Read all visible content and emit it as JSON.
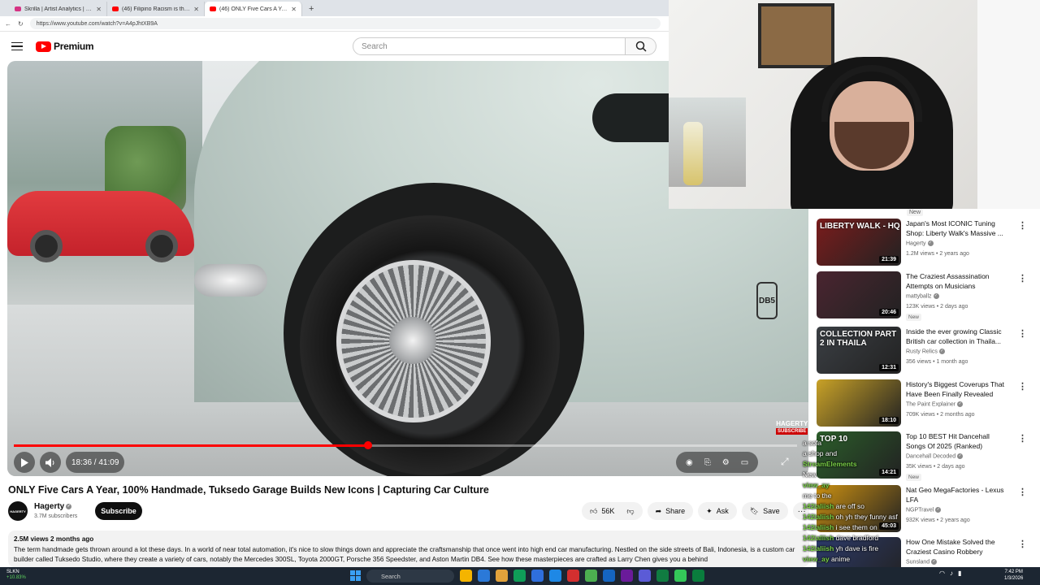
{
  "browser": {
    "tabs": [
      {
        "title": "Skrilla | Artist Analytics | Songstats",
        "fav_color": "#d63384"
      },
      {
        "title": "(46) Filipino Racism is the Most Cr",
        "fav_color": "#ff0000"
      },
      {
        "title": "(46) ONLY Five Cars A Year, 100% ..",
        "fav_color": "#ff0000"
      }
    ],
    "new_tab": "+",
    "url": "https://www.youtube.com/watch?v=A4pJhtXB9A"
  },
  "header": {
    "logo_text": "Premium",
    "search_placeholder": "Search"
  },
  "video": {
    "time_display": "18:36 / 41:09",
    "progress": 0.452,
    "db5_badge": "DB5",
    "watermark": "HAGERTY",
    "watermark_sub": "SUBSCRIBE"
  },
  "main": {
    "title": "ONLY Five Cars A Year, 100% Handmade, Tuksedo Garage Builds New Icons | Capturing Car Culture",
    "channel_name": "Hagerty",
    "avatar_text": "HAGERTY",
    "subscribers": "3.7M subscribers",
    "subscribe_label": "Subscribe",
    "likes": "56K",
    "share_label": "Share",
    "ask_label": "Ask",
    "save_label": "Save",
    "more_label": "···",
    "description_meta": "2.5M views  2 months ago",
    "description_text": "The term handmade gets thrown around a lot these days. In a world of near total automation, it's nice to slow things down and appreciate the craftsmanship that once went into high end car manufacturing. Nestled on the side streets of Bali, Indonesia, is a custom car builder called Tuksedo Studio, where they create a variety of cars, notably the Mercedes 300SL, Toyota 2000GT, Porsche 356 Speedster, and Aston Martin DB4. See how these masterpieces are crafted as Larry Chen gives you a behind"
  },
  "sidebar": {
    "top_badge": "New",
    "items": [
      {
        "title": "Japan's Most ICONIC Tuning Shop: Liberty Walk's Massive ...",
        "channel": "Hagerty",
        "meta": "1.2M views • 2 years ago",
        "duration": "21:39",
        "thumb_text": "LIBERTY WALK - HQ",
        "thumb_color": "#7a1c1c",
        "badge": ""
      },
      {
        "title": "The Craziest Assassination Attempts on Musicians",
        "channel": "mattyballz",
        "meta": "123K views • 2 days ago",
        "duration": "20:46",
        "thumb_text": "",
        "thumb_color": "#4a2530",
        "badge": "New"
      },
      {
        "title": "Inside the ever growing Classic British car collection in Thaila...",
        "channel": "Rusty Relics",
        "meta": "356 views • 1 month ago",
        "duration": "12:31",
        "thumb_text": "COLLECTION PART 2 IN THAILA",
        "thumb_color": "#3b3f44",
        "badge": ""
      },
      {
        "title": "History's Biggest Coverups That Have Been Finally Revealed",
        "channel": "The Paint Explainer",
        "meta": "709K views • 2 months ago",
        "duration": "18:10",
        "thumb_text": "",
        "thumb_color": "#c9a227",
        "badge": ""
      },
      {
        "title": "Top 10 BEST Hit Dancehall Songs Of 2025 (Ranked)",
        "channel": "Dancehall Decoded",
        "meta": "35K views • 2 days ago",
        "duration": "14:21",
        "thumb_text": "TOP 10",
        "thumb_color": "#2b5d2a",
        "badge": "New"
      },
      {
        "title": "Nat Geo MegaFactories - Lexus LFA",
        "channel": "NGPTravel",
        "meta": "932K views • 2 years ago",
        "duration": "45:03",
        "thumb_text": "",
        "thumb_color": "#c98f12",
        "badge": ""
      },
      {
        "title": "How One Mistake Solved the Craziest Casino Robbery",
        "channel": "Sunsland",
        "meta": "",
        "duration": "",
        "thumb_text": "",
        "thumb_color": "#2c3a6a",
        "badge": ""
      }
    ]
  },
  "chat": [
    {
      "user": "",
      "msg": "a sofa"
    },
    {
      "user": "",
      "msg": "a shop and"
    },
    {
      "user": "StreamElements",
      "msg": ""
    },
    {
      "user": "",
      "msg": "New"
    },
    {
      "user": "view_ay",
      "msg": ""
    },
    {
      "user": "",
      "msg": "me to the"
    },
    {
      "user": "142ialiish",
      "msg": "are off so"
    },
    {
      "user": "142ialiish",
      "msg": "oh yh they funny asf"
    },
    {
      "user": "142ialiish",
      "msg": "i see them on"
    },
    {
      "user": "142ialiish",
      "msg": "dave bradford"
    },
    {
      "user": "142ialiish",
      "msg": "yh dave is fire"
    },
    {
      "user": "view_ay",
      "msg": "anime"
    }
  ],
  "taskbar": {
    "stock_name": "SLKN",
    "stock_change": "+10.83%",
    "search_placeholder": "Search",
    "time": "7:42 PM",
    "date": "1/3/2026",
    "app_colors": [
      "#f4b400",
      "#2b79d8",
      "#e2a23b",
      "#0f9d58",
      "#2f6fdd",
      "#1e88e5",
      "#d32f2f",
      "#4caf50",
      "#1565c0",
      "#6a1b9a",
      "#5b5bd6",
      "#107c41",
      "#34c759",
      "#0a7d3d"
    ]
  }
}
